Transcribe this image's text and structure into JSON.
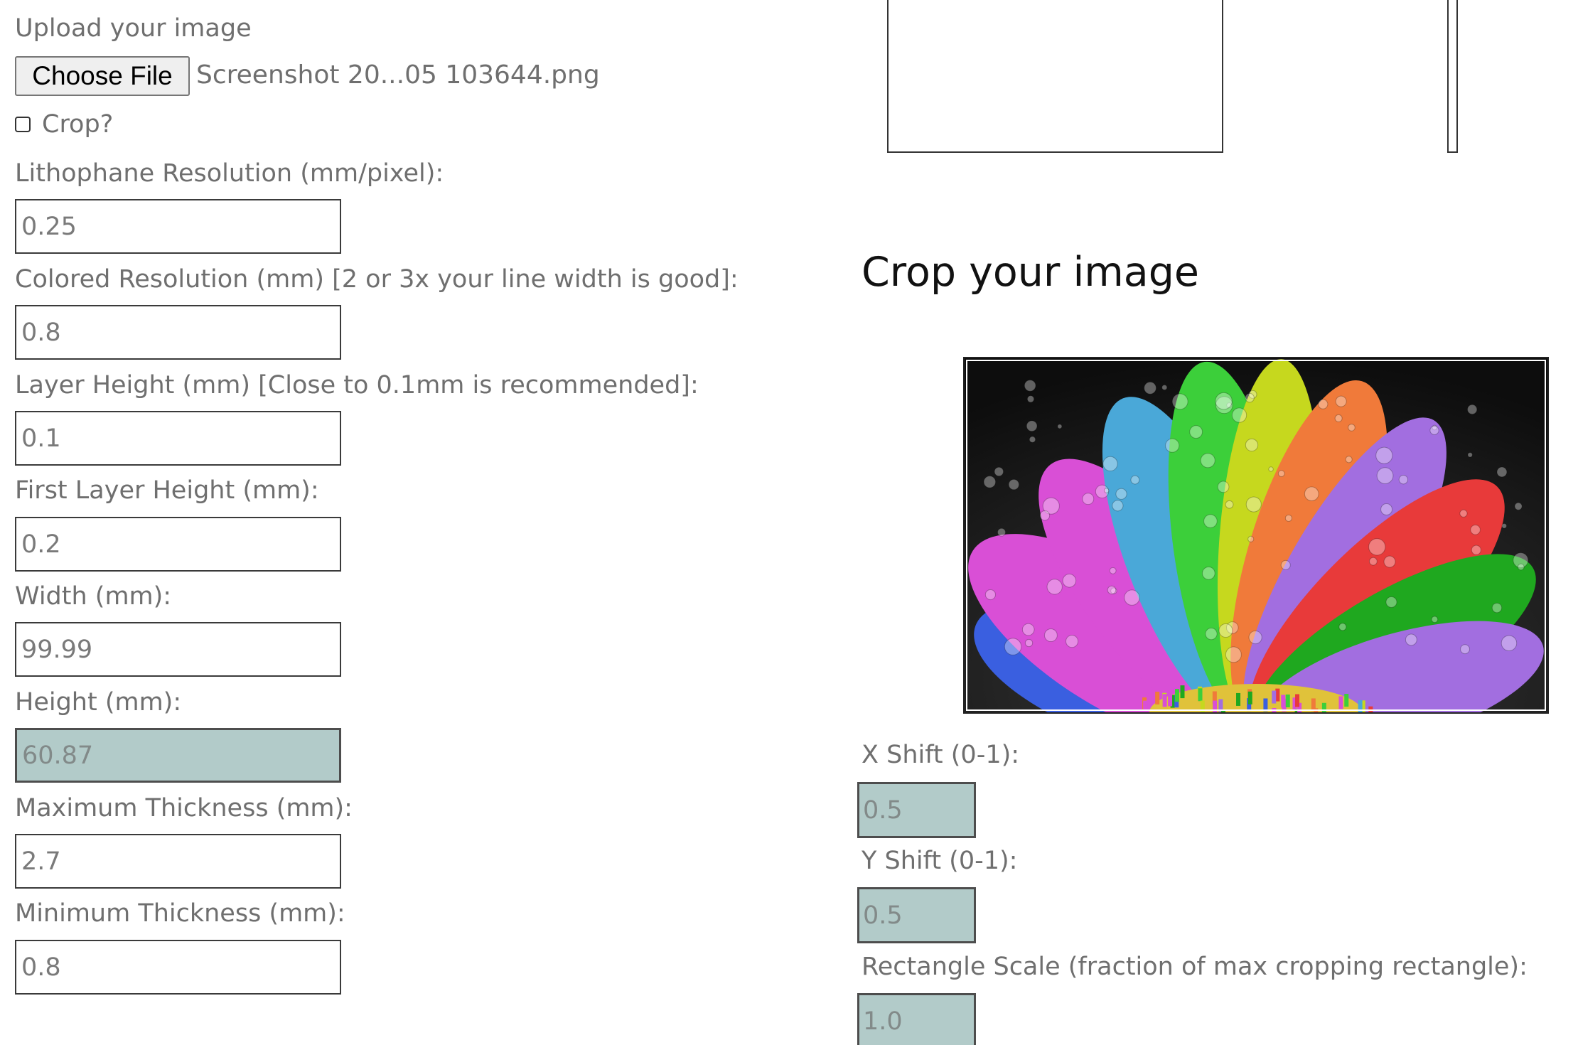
{
  "upload": {
    "label": "Upload your image",
    "button_label": "Choose File",
    "file_name": "Screenshot 20...05 103644.png"
  },
  "crop_toggle": {
    "label": "Crop?",
    "checked": false
  },
  "settings": [
    {
      "label": "Lithophane Resolution (mm/pixel):",
      "value": "0.25",
      "disabled": false
    },
    {
      "label": "Colored Resolution (mm) [2 or 3x your line width is good]:",
      "value": "0.8",
      "disabled": false
    },
    {
      "label": "Layer Height (mm) [Close to 0.1mm is recommended]:",
      "value": "0.1",
      "disabled": false
    },
    {
      "label": "First Layer Height (mm):",
      "value": "0.2",
      "disabled": false
    },
    {
      "label": "Width (mm):",
      "value": "99.99",
      "disabled": false
    },
    {
      "label": "Height (mm):",
      "value": "60.87",
      "disabled": true
    },
    {
      "label": "Maximum Thickness (mm):",
      "value": "2.7",
      "disabled": false
    },
    {
      "label": "Minimum Thickness (mm):",
      "value": "0.8",
      "disabled": false
    }
  ],
  "crop": {
    "title": "Crop your image",
    "x_shift_label": "X Shift (0-1):",
    "x_shift_value": "0.5",
    "y_shift_label": "Y Shift (0-1):",
    "y_shift_value": "0.5",
    "scale_label": "Rectangle Scale (fraction of max cropping rectangle):",
    "scale_value": "1.0"
  },
  "colors": {
    "disabled_field": "#b2cbc9",
    "label_text": "#6f6f6f",
    "title_text": "#111111",
    "petal_colors": [
      "#d94fd6",
      "#4aa8d8",
      "#3ccf3a",
      "#c6d81e",
      "#f07a3a",
      "#a26ee0",
      "#e83a3a",
      "#1fa81f",
      "#3a5fe0"
    ]
  }
}
